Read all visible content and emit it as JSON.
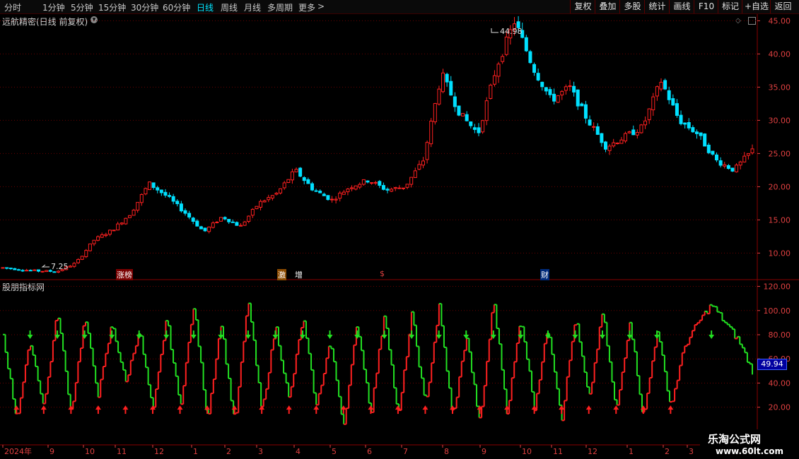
{
  "toolbar": {
    "periods": [
      "分时",
      "1分钟",
      "5分钟",
      "15分钟",
      "30分钟",
      "60分钟",
      "日线",
      "周线",
      "月线",
      "多周期",
      "更多"
    ],
    "active_period": "日线",
    "more_arrow": ">",
    "right_buttons": [
      "复权",
      "叠加",
      "多股",
      "统计",
      "画线",
      "F10",
      "标记",
      "+自选",
      "返回"
    ]
  },
  "main_panel": {
    "title": "远航精密(日线 前复权)",
    "high_label": "44.98",
    "low_label": "7.25",
    "events": [
      "涨榜",
      "激",
      "增",
      "$",
      "财"
    ]
  },
  "indicator_panel": {
    "title": "股朋指标网",
    "current_value": "49.94"
  },
  "watermark": {
    "line1": "乐淘公式网",
    "line2": "www.60lt.com"
  },
  "colors": {
    "up": "#ff2020",
    "down": "#00e0ff",
    "ind_up": "#ff2020",
    "ind_down": "#22e022",
    "grid": "#6a0000",
    "axis": "#e04040"
  },
  "chart_data": [
    {
      "type": "line",
      "title": "远航精密(日线 前复权)",
      "y_ticks": [
        10,
        15,
        20,
        25,
        30,
        35,
        40,
        45
      ],
      "ylim": [
        6,
        46
      ],
      "x": [
        "2024年",
        "9",
        "10",
        "11",
        "12",
        "1",
        "2",
        "3",
        "4",
        "5",
        "6",
        "7",
        "8",
        "9",
        "10",
        "11",
        "12",
        "1",
        "2",
        "3"
      ],
      "series": [
        {
          "values": [
            7.8,
            7.5,
            7.3,
            7.25,
            8.5,
            12.0,
            13.5,
            16.0,
            20.5,
            18.5,
            16.0,
            13.2,
            15.5,
            14.0,
            17.5,
            19.0,
            22.5,
            19.5,
            18.0,
            20.0,
            21.0,
            19.5,
            20.0,
            24.0,
            37.0,
            31.0,
            28.0,
            38.0,
            44.98,
            38.0,
            33.0,
            35.0,
            30.0,
            26.0,
            27.5,
            29.0,
            36.0,
            30.0,
            28.0,
            24.0,
            22.5,
            25.5
          ]
        }
      ]
    },
    {
      "type": "line",
      "title": "股朋指标网",
      "y_ticks": [
        20,
        40,
        60,
        80,
        100,
        120
      ],
      "ylim": [
        -10,
        125
      ],
      "x": [
        "2024年",
        "9",
        "10",
        "11",
        "12",
        "1",
        "2",
        "3",
        "4",
        "5",
        "6",
        "7",
        "8",
        "9",
        "10",
        "11",
        "12",
        "1",
        "2",
        "3"
      ],
      "series": [
        {
          "values": [
            80,
            10,
            75,
            20,
            100,
            15,
            95,
            30,
            90,
            40,
            85,
            15,
            95,
            20,
            105,
            10,
            90,
            5,
            110,
            15,
            88,
            25,
            95,
            20,
            75,
            5,
            90,
            15,
            100,
            10,
            98,
            20,
            104,
            10,
            80,
            5,
            110,
            15,
            95,
            20,
            88,
            10,
            95,
            25,
            100,
            15,
            93,
            10,
            85,
            20,
            70,
            90,
            105,
            90,
            75,
            49.94
          ]
        }
      ]
    }
  ]
}
